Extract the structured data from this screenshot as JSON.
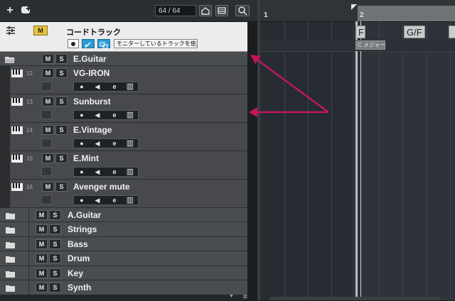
{
  "toolbar": {
    "add_icon": "+",
    "counter": "64 / 64"
  },
  "chord_track": {
    "label": "コードトラック",
    "m_label": "M",
    "monitor_label": "モニターしているトラックを使用"
  },
  "folder_guitar": {
    "name": "E.Guitar",
    "m": "M",
    "s": "S"
  },
  "tracks": [
    {
      "num": "12",
      "name": "VG-IRON",
      "m": "M",
      "s": "S"
    },
    {
      "num": "13",
      "name": "Sunburst",
      "m": "M",
      "s": "S"
    },
    {
      "num": "14",
      "name": "E.Vintage",
      "m": "M",
      "s": "S"
    },
    {
      "num": "15",
      "name": "E.Mint",
      "m": "M",
      "s": "S"
    },
    {
      "num": "16",
      "name": "Avenger mute",
      "m": "M",
      "s": "S"
    }
  ],
  "folders": [
    {
      "name": "A.Guitar",
      "m": "M",
      "s": "S"
    },
    {
      "name": "Strings",
      "m": "M",
      "s": "S"
    },
    {
      "name": "Bass",
      "m": "M",
      "s": "S"
    },
    {
      "name": "Drum",
      "m": "M",
      "s": "S"
    },
    {
      "name": "Key",
      "m": "M",
      "s": "S"
    },
    {
      "name": "Synth",
      "m": "M",
      "s": "S"
    }
  ],
  "ruler": {
    "bar1": "1",
    "bar2": "2"
  },
  "chords": {
    "c1": "F",
    "c2": "G/F",
    "scale": "C メジャー"
  },
  "colors": {
    "accent_yellow": "#e8c23a",
    "arrow": "#c4145c"
  }
}
